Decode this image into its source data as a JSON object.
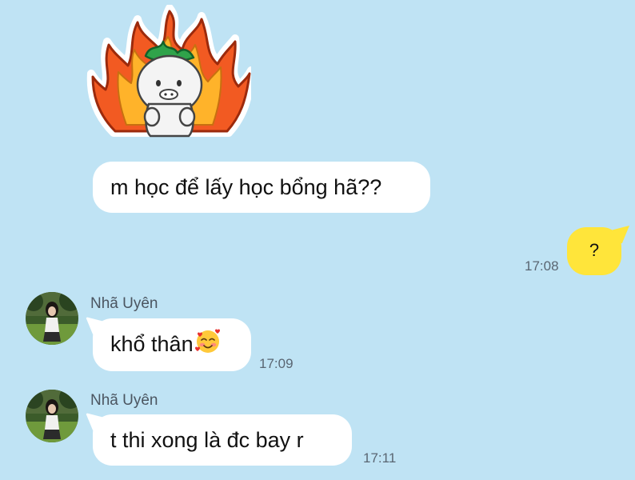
{
  "colors": {
    "background": "#bfe3f4",
    "incoming_bubble": "#ffffff",
    "outgoing_bubble": "#ffe53a"
  },
  "messages": [
    {
      "direction": "in",
      "type": "sticker",
      "icon": "fire-sticker-icon"
    },
    {
      "direction": "in",
      "text": "m học để lấy học bổng hã??"
    },
    {
      "direction": "out",
      "text": "?",
      "time": "17:08"
    },
    {
      "direction": "in",
      "sender": "Nhã Uyên",
      "text": "khổ thân",
      "emoji": "smiling-face-with-hearts-icon",
      "time": "17:09"
    },
    {
      "direction": "in",
      "sender": "Nhã Uyên",
      "text": "t thi xong là đc bay r",
      "time": "17:11"
    }
  ]
}
